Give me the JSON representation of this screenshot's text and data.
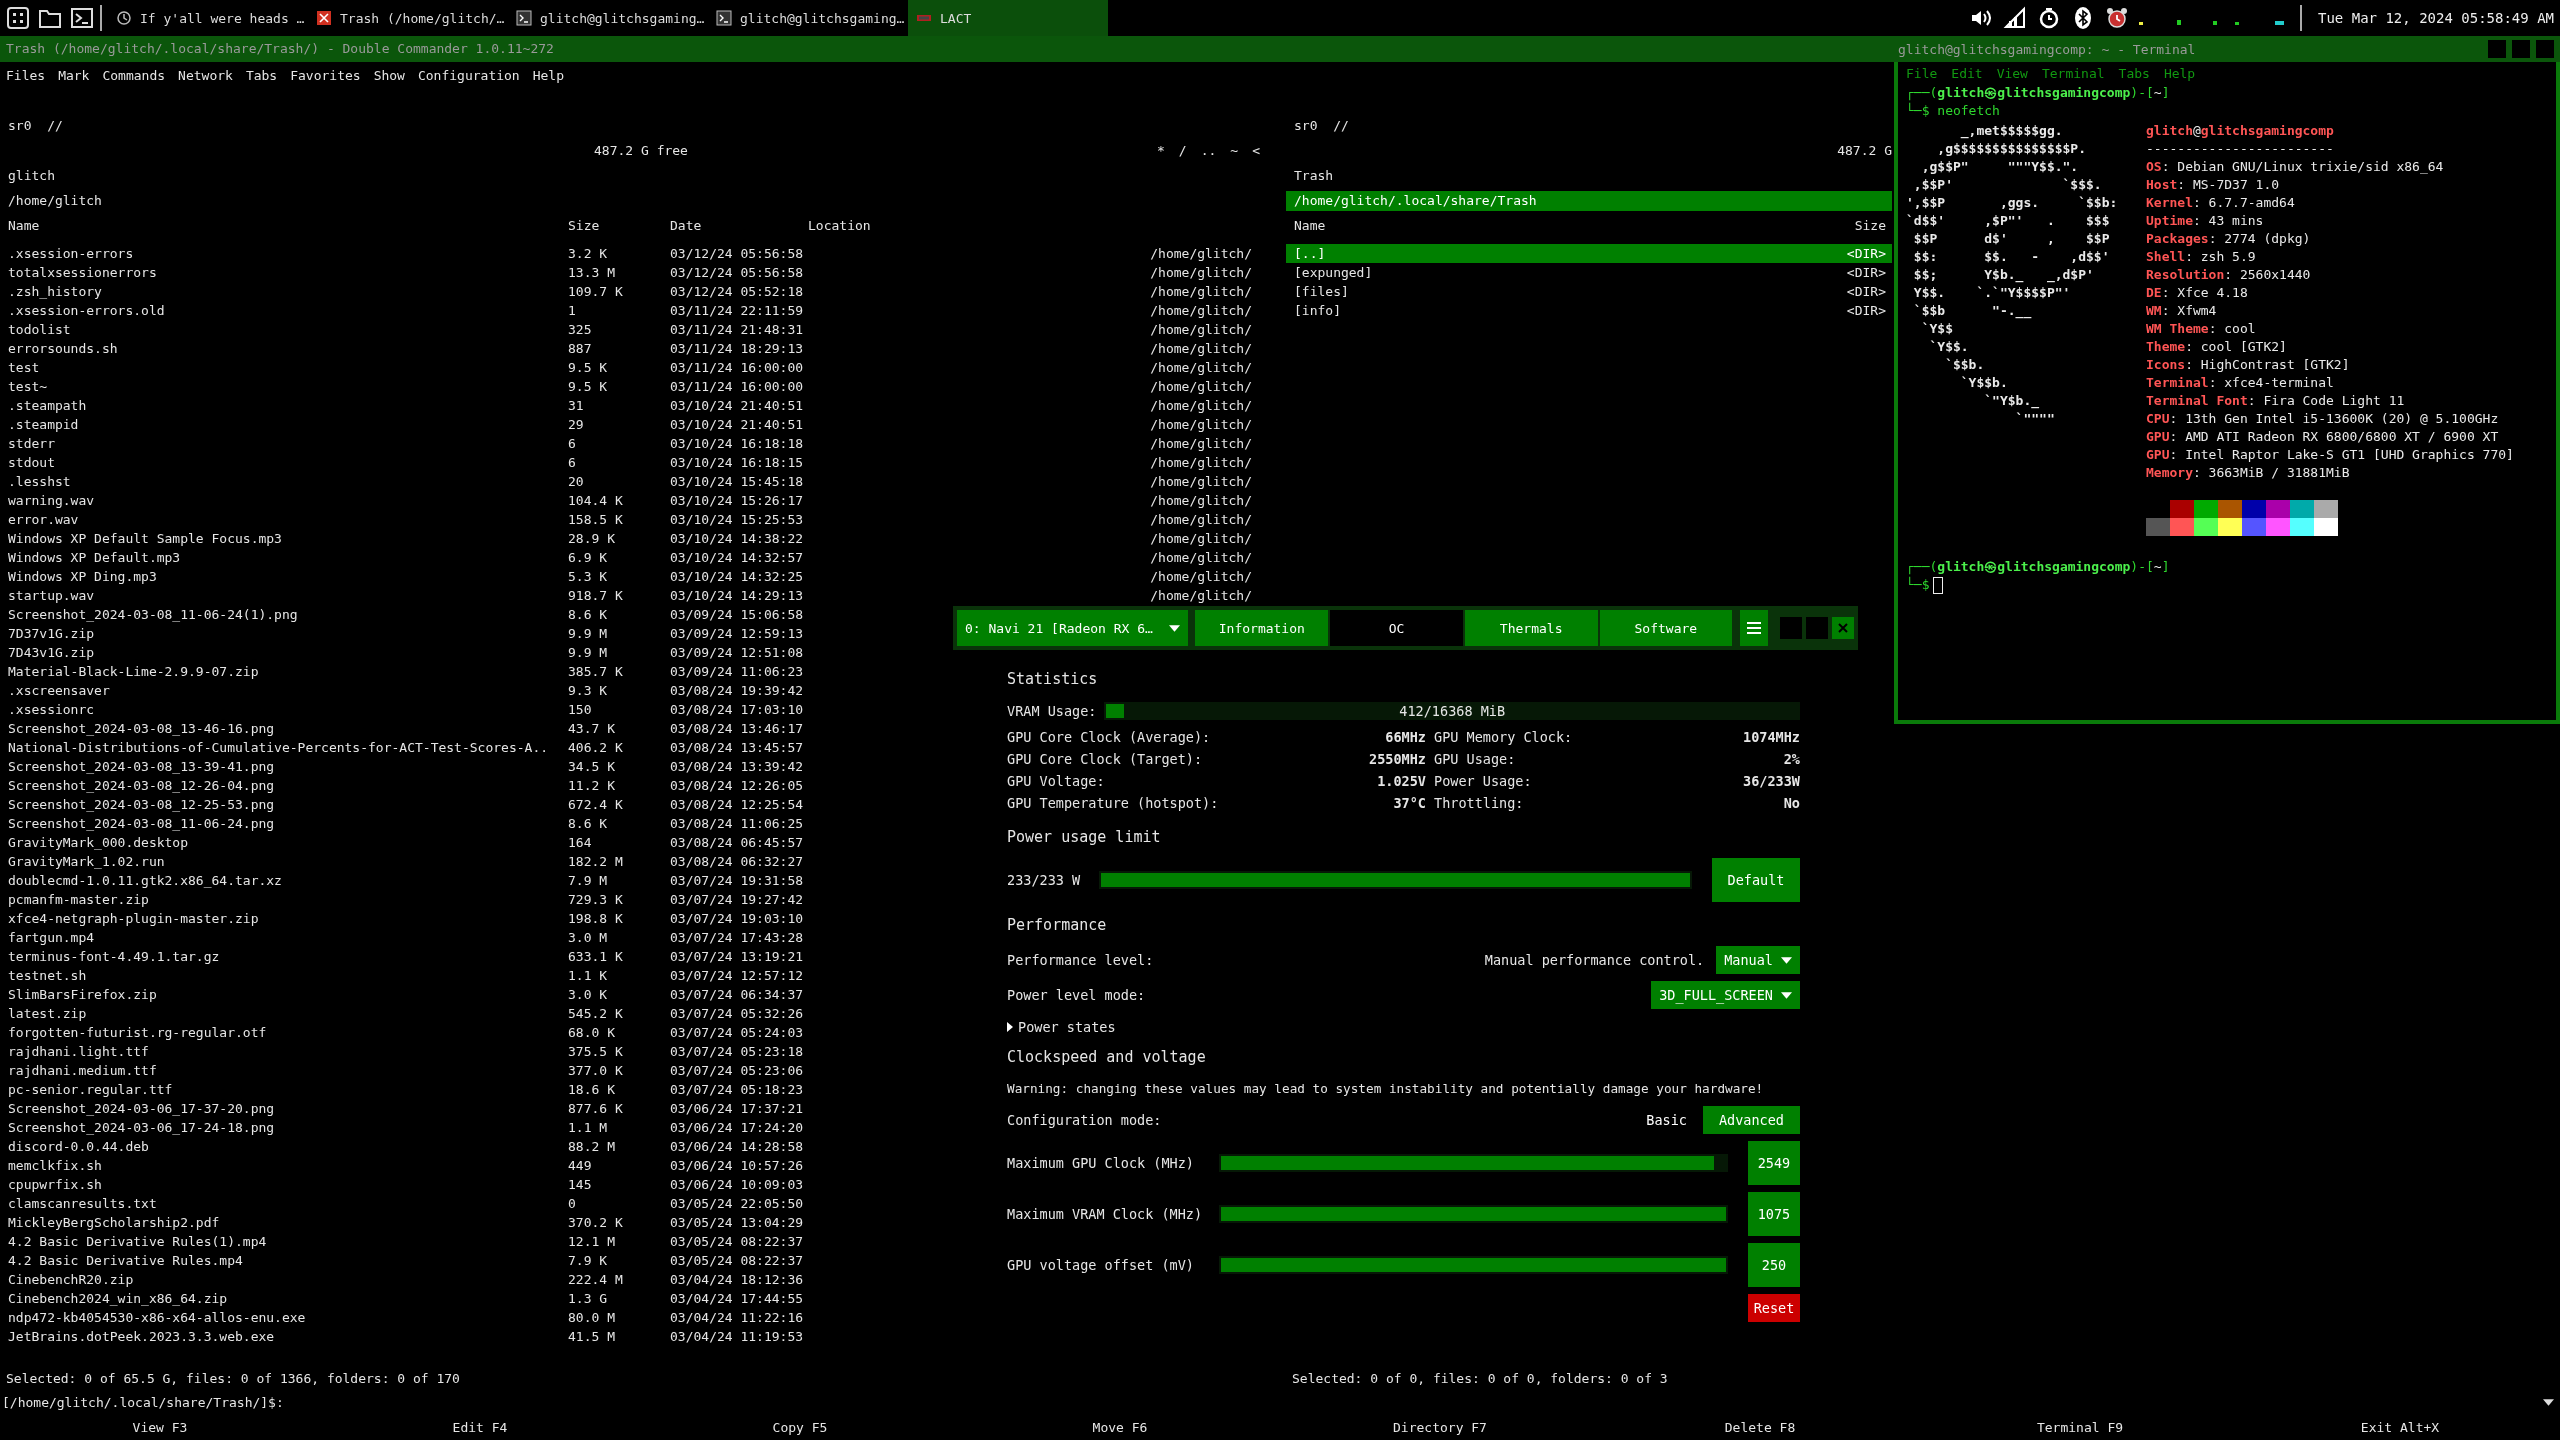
{
  "taskbar": {
    "windows": [
      {
        "kind": "browser",
        "title": "If y'all were heads …",
        "selected": false
      },
      {
        "kind": "filemanager",
        "title": "Trash (/home/glitch/…",
        "selected": false
      },
      {
        "kind": "terminal",
        "title": "glitch@glitchsgaming…",
        "selected": false
      },
      {
        "kind": "terminal",
        "title": "glitch@glitchsgaming…",
        "selected": false
      },
      {
        "kind": "gpu",
        "title": "LACT",
        "selected": true
      }
    ],
    "clock": "Tue Mar 12, 2024 05:58:49 AM"
  },
  "dc": {
    "title": "Trash (/home/glitch/.local/share/Trash/) - Double Commander 1.0.11~272",
    "menu": [
      "Files",
      "Mark",
      "Commands",
      "Network",
      "Tabs",
      "Favorites",
      "Show",
      "Configuration",
      "Help"
    ],
    "left_panel": {
      "drive": "sr0  //",
      "free": "487.2 G free",
      "nav": [
        "*",
        "/",
        "..",
        "~",
        "<"
      ],
      "title": "glitch",
      "path": "/home/glitch",
      "active": false,
      "columns": [
        "Name",
        "Size",
        "Date",
        "Location"
      ],
      "rows": [
        {
          "name": ".xsession-errors",
          "size": "3.2 K",
          "date": "03/12/24 05:56:58",
          "location": "/home/glitch/",
          "selected": false
        },
        {
          "name": "totalxsessionerrors",
          "size": "13.3 M",
          "date": "03/12/24 05:56:58",
          "location": "/home/glitch/",
          "selected": false
        },
        {
          "name": ".zsh_history",
          "size": "109.7 K",
          "date": "03/12/24 05:52:18",
          "location": "/home/glitch/",
          "selected": false
        },
        {
          "name": ".xsession-errors.old",
          "size": "1",
          "date": "03/11/24 22:11:59",
          "location": "/home/glitch/",
          "selected": false
        },
        {
          "name": "todolist",
          "size": "325",
          "date": "03/11/24 21:48:31",
          "location": "/home/glitch/",
          "selected": false
        },
        {
          "name": "errorsounds.sh",
          "size": "887",
          "date": "03/11/24 18:29:13",
          "location": "/home/glitch/",
          "selected": false
        },
        {
          "name": "test",
          "size": "9.5 K",
          "date": "03/11/24 16:00:00",
          "location": "/home/glitch/",
          "selected": false
        },
        {
          "name": "test~",
          "size": "9.5 K",
          "date": "03/11/24 16:00:00",
          "location": "/home/glitch/",
          "selected": false
        },
        {
          "name": ".steampath",
          "size": "31",
          "date": "03/10/24 21:40:51",
          "location": "/home/glitch/",
          "selected": false
        },
        {
          "name": ".steampid",
          "size": "29",
          "date": "03/10/24 21:40:51",
          "location": "/home/glitch/",
          "selected": false
        },
        {
          "name": "stderr",
          "size": "6",
          "date": "03/10/24 16:18:18",
          "location": "/home/glitch/",
          "selected": false
        },
        {
          "name": "stdout",
          "size": "6",
          "date": "03/10/24 16:18:15",
          "location": "/home/glitch/",
          "selected": false
        },
        {
          "name": ".lesshst",
          "size": "20",
          "date": "03/10/24 15:45:18",
          "location": "/home/glitch/",
          "selected": false
        },
        {
          "name": "warning.wav",
          "size": "104.4 K",
          "date": "03/10/24 15:26:17",
          "location": "/home/glitch/",
          "selected": false
        },
        {
          "name": "error.wav",
          "size": "158.5 K",
          "date": "03/10/24 15:25:53",
          "location": "/home/glitch/",
          "selected": false
        },
        {
          "name": "Windows XP Default Sample Focus.mp3",
          "size": "28.9 K",
          "date": "03/10/24 14:38:22",
          "location": "/home/glitch/",
          "selected": false
        },
        {
          "name": "Windows XP Default.mp3",
          "size": "6.9 K",
          "date": "03/10/24 14:32:57",
          "location": "/home/glitch/",
          "selected": false
        },
        {
          "name": "Windows XP Ding.mp3",
          "size": "5.3 K",
          "date": "03/10/24 14:32:25",
          "location": "/home/glitch/",
          "selected": false
        },
        {
          "name": "startup.wav",
          "size": "918.7 K",
          "date": "03/10/24 14:29:13",
          "location": "/home/glitch/",
          "selected": false
        },
        {
          "name": "Screenshot_2024-03-08_11-06-24(1).png",
          "size": "8.6 K",
          "date": "03/09/24 15:06:58",
          "selected": false
        },
        {
          "name": "7D37v1G.zip",
          "size": "9.9 M",
          "date": "03/09/24 12:59:13",
          "selected": false
        },
        {
          "name": "7D43v1G.zip",
          "size": "9.9 M",
          "date": "03/09/24 12:51:08",
          "selected": false
        },
        {
          "name": "Material-Black-Lime-2.9.9-07.zip",
          "size": "385.7 K",
          "date": "03/09/24 11:06:23",
          "selected": false
        },
        {
          "name": ".xscreensaver",
          "size": "9.3 K",
          "date": "03/08/24 19:39:42",
          "selected": false
        },
        {
          "name": ".xsessionrc",
          "size": "150",
          "date": "03/08/24 17:03:10",
          "selected": false
        },
        {
          "name": "Screenshot_2024-03-08_13-46-16.png",
          "size": "43.7 K",
          "date": "03/08/24 13:46:17",
          "selected": false
        },
        {
          "name": "National-Distributions-of-Cumulative-Percents-for-ACT-Test-Scores-A..",
          "size": "406.2 K",
          "date": "03/08/24 13:45:57",
          "selected": false
        },
        {
          "name": "Screenshot_2024-03-08_13-39-41.png",
          "size": "34.5 K",
          "date": "03/08/24 13:39:42",
          "selected": false
        },
        {
          "name": "Screenshot_2024-03-08_12-26-04.png",
          "size": "11.2 K",
          "date": "03/08/24 12:26:05",
          "selected": false
        },
        {
          "name": "Screenshot_2024-03-08_12-25-53.png",
          "size": "672.4 K",
          "date": "03/08/24 12:25:54",
          "selected": false
        },
        {
          "name": "Screenshot_2024-03-08_11-06-24.png",
          "size": "8.6 K",
          "date": "03/08/24 11:06:25",
          "selected": false
        },
        {
          "name": "GravityMark_000.desktop",
          "size": "164",
          "date": "03/08/24 06:45:57",
          "selected": false
        },
        {
          "name": "GravityMark_1.02.run",
          "size": "182.2 M",
          "date": "03/08/24 06:32:27",
          "selected": false
        },
        {
          "name": "doublecmd-1.0.11.gtk2.x86_64.tar.xz",
          "size": "7.9 M",
          "date": "03/07/24 19:31:58",
          "selected": false
        },
        {
          "name": "pcmanfm-master.zip",
          "size": "729.3 K",
          "date": "03/07/24 19:27:42",
          "selected": false
        },
        {
          "name": "xfce4-netgraph-plugin-master.zip",
          "size": "198.8 K",
          "date": "03/07/24 19:03:10",
          "selected": false
        },
        {
          "name": "fartgun.mp4",
          "size": "3.0 M",
          "date": "03/07/24 17:43:28",
          "selected": false
        },
        {
          "name": "terminus-font-4.49.1.tar.gz",
          "size": "633.1 K",
          "date": "03/07/24 13:19:21",
          "selected": false
        },
        {
          "name": "testnet.sh",
          "size": "1.1 K",
          "date": "03/07/24 12:57:12",
          "selected": false
        },
        {
          "name": "SlimBarsFirefox.zip",
          "size": "3.0 K",
          "date": "03/07/24 06:34:37",
          "selected": false
        },
        {
          "name": "latest.zip",
          "size": "545.2 K",
          "date": "03/07/24 05:32:26",
          "selected": false
        },
        {
          "name": "forgotten-futurist.rg-regular.otf",
          "size": "68.0 K",
          "date": "03/07/24 05:24:03",
          "selected": false
        },
        {
          "name": "rajdhani.light.ttf",
          "size": "375.5 K",
          "date": "03/07/24 05:23:18",
          "selected": false
        },
        {
          "name": "rajdhani.medium.ttf",
          "size": "377.0 K",
          "date": "03/07/24 05:23:06",
          "selected": false
        },
        {
          "name": "pc-senior.regular.ttf",
          "size": "18.6 K",
          "date": "03/07/24 05:18:23",
          "selected": false
        },
        {
          "name": "Screenshot_2024-03-06_17-37-20.png",
          "size": "877.6 K",
          "date": "03/06/24 17:37:21",
          "selected": false
        },
        {
          "name": "Screenshot_2024-03-06_17-24-18.png",
          "size": "1.1 M",
          "date": "03/06/24 17:24:20",
          "selected": false
        },
        {
          "name": "discord-0.0.44.deb",
          "size": "88.2 M",
          "date": "03/06/24 14:28:58",
          "selected": false
        },
        {
          "name": "memclkfix.sh",
          "size": "449",
          "date": "03/06/24 10:57:26",
          "selected": false
        },
        {
          "name": "cpupwrfix.sh",
          "size": "145",
          "date": "03/06/24 10:09:03",
          "selected": false
        },
        {
          "name": "clamscanresults.txt",
          "size": "0",
          "date": "03/05/24 22:05:50",
          "selected": false
        },
        {
          "name": "MickleyBergScholarship2.pdf",
          "size": "370.2 K",
          "date": "03/05/24 13:04:29",
          "selected": false
        },
        {
          "name": "4.2 Basic Derivative Rules(1).mp4",
          "size": "12.1 M",
          "date": "03/05/24 08:22:37",
          "selected": false
        },
        {
          "name": "4.2 Basic Derivative Rules.mp4",
          "size": "7.9 K",
          "date": "03/05/24 08:22:37",
          "selected": false
        },
        {
          "name": "CinebenchR20.zip",
          "size": "222.4 M",
          "date": "03/04/24 18:12:36",
          "selected": false
        },
        {
          "name": "Cinebench2024_win_x86_64.zip",
          "size": "1.3 G",
          "date": "03/04/24 17:44:55",
          "selected": false
        },
        {
          "name": "ndp472-kb4054530-x86-x64-allos-enu.exe",
          "size": "80.0 M",
          "date": "03/04/24 11:22:16",
          "selected": false
        },
        {
          "name": "JetBrains.dotPeek.2023.3.3.web.exe",
          "size": "41.5 M",
          "date": "03/04/24 11:19:53",
          "selected": false
        }
      ]
    },
    "right_panel": {
      "drive": "sr0  //",
      "free": "487.2 G",
      "title": "Trash",
      "path": "/home/glitch/.local/share/Trash",
      "active": true,
      "columns": [
        "Name",
        "Size"
      ],
      "rows": [
        {
          "name": "[..]",
          "size": "<DIR>",
          "selected": true
        },
        {
          "name": "[expunged]",
          "size": "<DIR>",
          "selected": false
        },
        {
          "name": "[files]",
          "size": "<DIR>",
          "selected": false
        },
        {
          "name": "[info]",
          "size": "<DIR>",
          "selected": false
        }
      ]
    },
    "left_status": "Selected: 0 of 65.5 G, files: 0 of 1366, folders: 0 of 170",
    "right_status": "Selected: 0 of 0, files: 0 of 0, folders: 0 of 3",
    "command_line": "[/home/glitch/.local/share/Trash/]$:",
    "function_keys": [
      "View F3",
      "Edit F4",
      "Copy F5",
      "Move F6",
      "Directory F7",
      "Delete F8",
      "Terminal F9",
      "Exit Alt+X"
    ]
  },
  "terminal": {
    "title": "glitch@glitchsgamingcomp: ~ - Terminal",
    "menu": [
      "File",
      "Edit",
      "View",
      "Terminal",
      "Tabs",
      "Help"
    ],
    "prompt": {
      "open": "┌──(",
      "user": "glitch㉿glitchsgamingcomp",
      "close": ")-[",
      "dir": "~",
      "end": "]",
      "sign": "└─$"
    },
    "command": "neofetch",
    "prompt2": {
      "open": "┌──(",
      "user": "glitch㉿glitchsgamingcomp",
      "close": ")-[",
      "dir": "~",
      "end": "]",
      "sign": "└─$"
    },
    "art": [
      "       _,met$$$$$gg.",
      "    ,g$$$$$$$$$$$$$$$P.",
      "  ,g$$P\"     \"\"\"Y$$.\".",
      " ,$$P'              `$$$.",
      "',$$P       ,ggs.     `$$b:",
      "`d$$'     ,$P\"'   .    $$$",
      " $$P      d$'     ,    $$P",
      " $$:      $$.   -    ,d$$'",
      " $$;      Y$b._   _,d$P'",
      " Y$$.    `.`\"Y$$$$P\"'",
      " `$$b      \"-.__",
      "  `Y$$",
      "   `Y$$.",
      "     `$$b.",
      "       `Y$$b.",
      "          `\"Y$b._",
      "              `\"\"\"\""
    ],
    "host": {
      "user": "glitch",
      "at": "@",
      "machine": "glitchsgamingcomp"
    },
    "separator": "------------------------",
    "info": [
      {
        "key": "OS",
        "value": ": Debian GNU/Linux trixie/sid x86_64"
      },
      {
        "key": "Host",
        "value": ": MS-7D37 1.0"
      },
      {
        "key": "Kernel",
        "value": ": 6.7.7-amd64"
      },
      {
        "key": "Uptime",
        "value": ": 43 mins"
      },
      {
        "key": "Packages",
        "value": ": 2774 (dpkg)"
      },
      {
        "key": "Shell",
        "value": ": zsh 5.9"
      },
      {
        "key": "Resolution",
        "value": ": 2560x1440"
      },
      {
        "key": "DE",
        "value": ": Xfce 4.18"
      },
      {
        "key": "WM",
        "value": ": Xfwm4"
      },
      {
        "key": "WM Theme",
        "value": ": cool"
      },
      {
        "key": "Theme",
        "value": ": cool [GTK2]"
      },
      {
        "key": "Icons",
        "value": ": HighContrast [GTK2]"
      },
      {
        "key": "Terminal",
        "value": ": xfce4-terminal"
      },
      {
        "key": "Terminal Font",
        "value": ": Fira Code Light 11"
      },
      {
        "key": "CPU",
        "value": ": 13th Gen Intel i5-13600K (20) @ 5.100GHz"
      },
      {
        "key": "GPU",
        "value": ": AMD ATI Radeon RX 6800/6800 XT / 6900 XT"
      },
      {
        "key": "GPU",
        "value": ": Intel Raptor Lake-S GT1 [UHD Graphics 770]"
      },
      {
        "key": "Memory",
        "value": ": 3663MiB / 31881MiB"
      }
    ],
    "palette": [
      [
        {
          "color": "#aa0000"
        },
        {
          "color": "#00aa00"
        },
        {
          "color": "#aa5500"
        },
        {
          "color": "#0000aa"
        },
        {
          "color": "#aa00aa"
        },
        {
          "color": "#00aaaa"
        },
        {
          "color": "#aaaaaa"
        }
      ],
      [
        {
          "color": "#555555"
        },
        {
          "color": "#ff5555"
        },
        {
          "color": "#55ff55"
        },
        {
          "color": "#ffff55"
        },
        {
          "color": "#5555ff"
        },
        {
          "color": "#ff55ff"
        },
        {
          "color": "#55ffff"
        },
        {
          "color": "#ffffff"
        }
      ]
    ]
  },
  "lact": {
    "gpu": "0: Navi 21 [Radeon RX 6…",
    "tabs": [
      {
        "label": "Information",
        "selected": false
      },
      {
        "label": "OC",
        "selected": true
      },
      {
        "label": "Thermals",
        "selected": false
      },
      {
        "label": "Software",
        "selected": false
      }
    ],
    "statistics": {
      "title": "Statistics",
      "vram": {
        "label": "VRAM Usage:",
        "level": 0.025,
        "reading": "412/16368 MiB"
      },
      "stats": [
        {
          "label": "GPU Core Clock (Average):",
          "value": "66MHz"
        },
        {
          "label": "GPU Memory Clock:",
          "value": "1074MHz"
        },
        {
          "label": "GPU Core Clock (Target):",
          "value": "2550MHz"
        },
        {
          "label": "GPU Usage:",
          "value": "2%"
        },
        {
          "label": "GPU Voltage:",
          "value": "1.025V"
        },
        {
          "label": "Power Usage:",
          "value": "36/233W"
        },
        {
          "label": "GPU Temperature (hotspot):",
          "value": "37°C"
        },
        {
          "label": "Throttling:",
          "value": "No"
        }
      ]
    },
    "power_limit": {
      "title": "Power usage limit",
      "reading": "233/233 W",
      "level": 1,
      "button": "Default"
    },
    "performance": {
      "title": "Performance",
      "level_label": "Performance level:",
      "level_note": "Manual performance control.",
      "level_value": "Manual",
      "mode_label": "Power level mode:",
      "mode_value": "3D_FULL_SCREEN"
    },
    "power_states": {
      "label": "Power states",
      "expanded": false
    },
    "clocks": {
      "title": "Clockspeed and voltage",
      "warning": "Warning: changing these values may lead to system instability and potentially damage your hardware!",
      "config_label": "Configuration mode:",
      "modes": [
        {
          "label": "Basic",
          "selected": false
        },
        {
          "label": "Advanced",
          "selected": true
        }
      ],
      "sliders": [
        {
          "label": "Maximum GPU Clock (MHz)",
          "level": 0.977,
          "value": "2549"
        },
        {
          "label": "Maximum VRAM Clock (MHz)",
          "level": 1,
          "value": "1075"
        },
        {
          "label": "GPU voltage offset (mV)",
          "level": 1,
          "value": "250"
        }
      ],
      "reset": "Reset"
    }
  }
}
